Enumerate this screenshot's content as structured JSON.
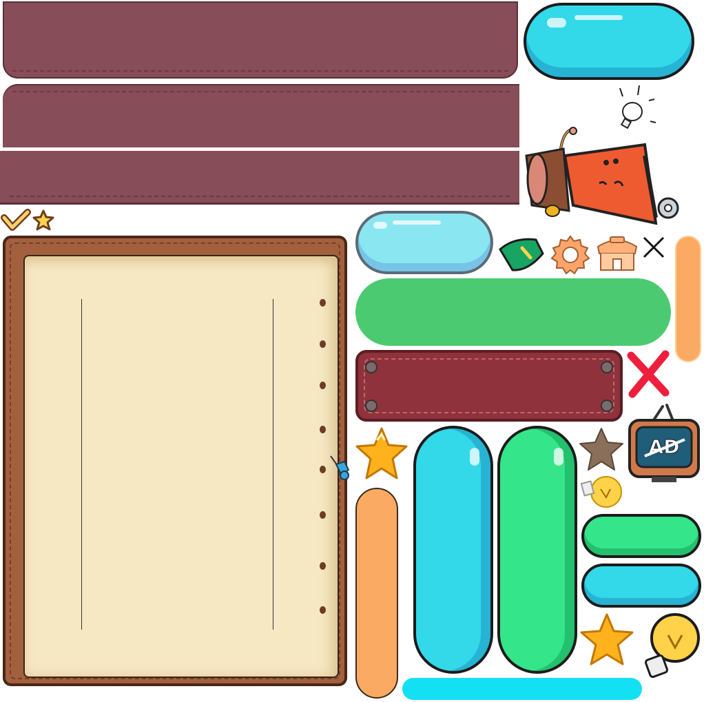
{
  "atlas": {
    "ad_tv_label": "AD"
  },
  "colors": {
    "panel_maroon": "#874d58",
    "plaque_red": "#8f323c",
    "frame_brown": "#a3603f",
    "parchment": "#f7e8c4",
    "button_cyan": "#33d8e9",
    "button_light_blue": "#8ae6f1",
    "button_green": "#4cca72",
    "button_mint": "#35e58a",
    "bar_orange": "#fbaa63",
    "bar_cyan": "#13e0f2",
    "star_gold": "#ffb21b",
    "close_red": "#ee1f3c"
  },
  "icons": [
    "checkmark-icon",
    "star-icon",
    "lightbulb-icon",
    "mascot-character",
    "leaf-badge-icon",
    "gear-icon",
    "shop-icon",
    "close-icon",
    "close-red-icon",
    "pushpin-icon",
    "star-brown-icon",
    "ad-tv-icon"
  ]
}
